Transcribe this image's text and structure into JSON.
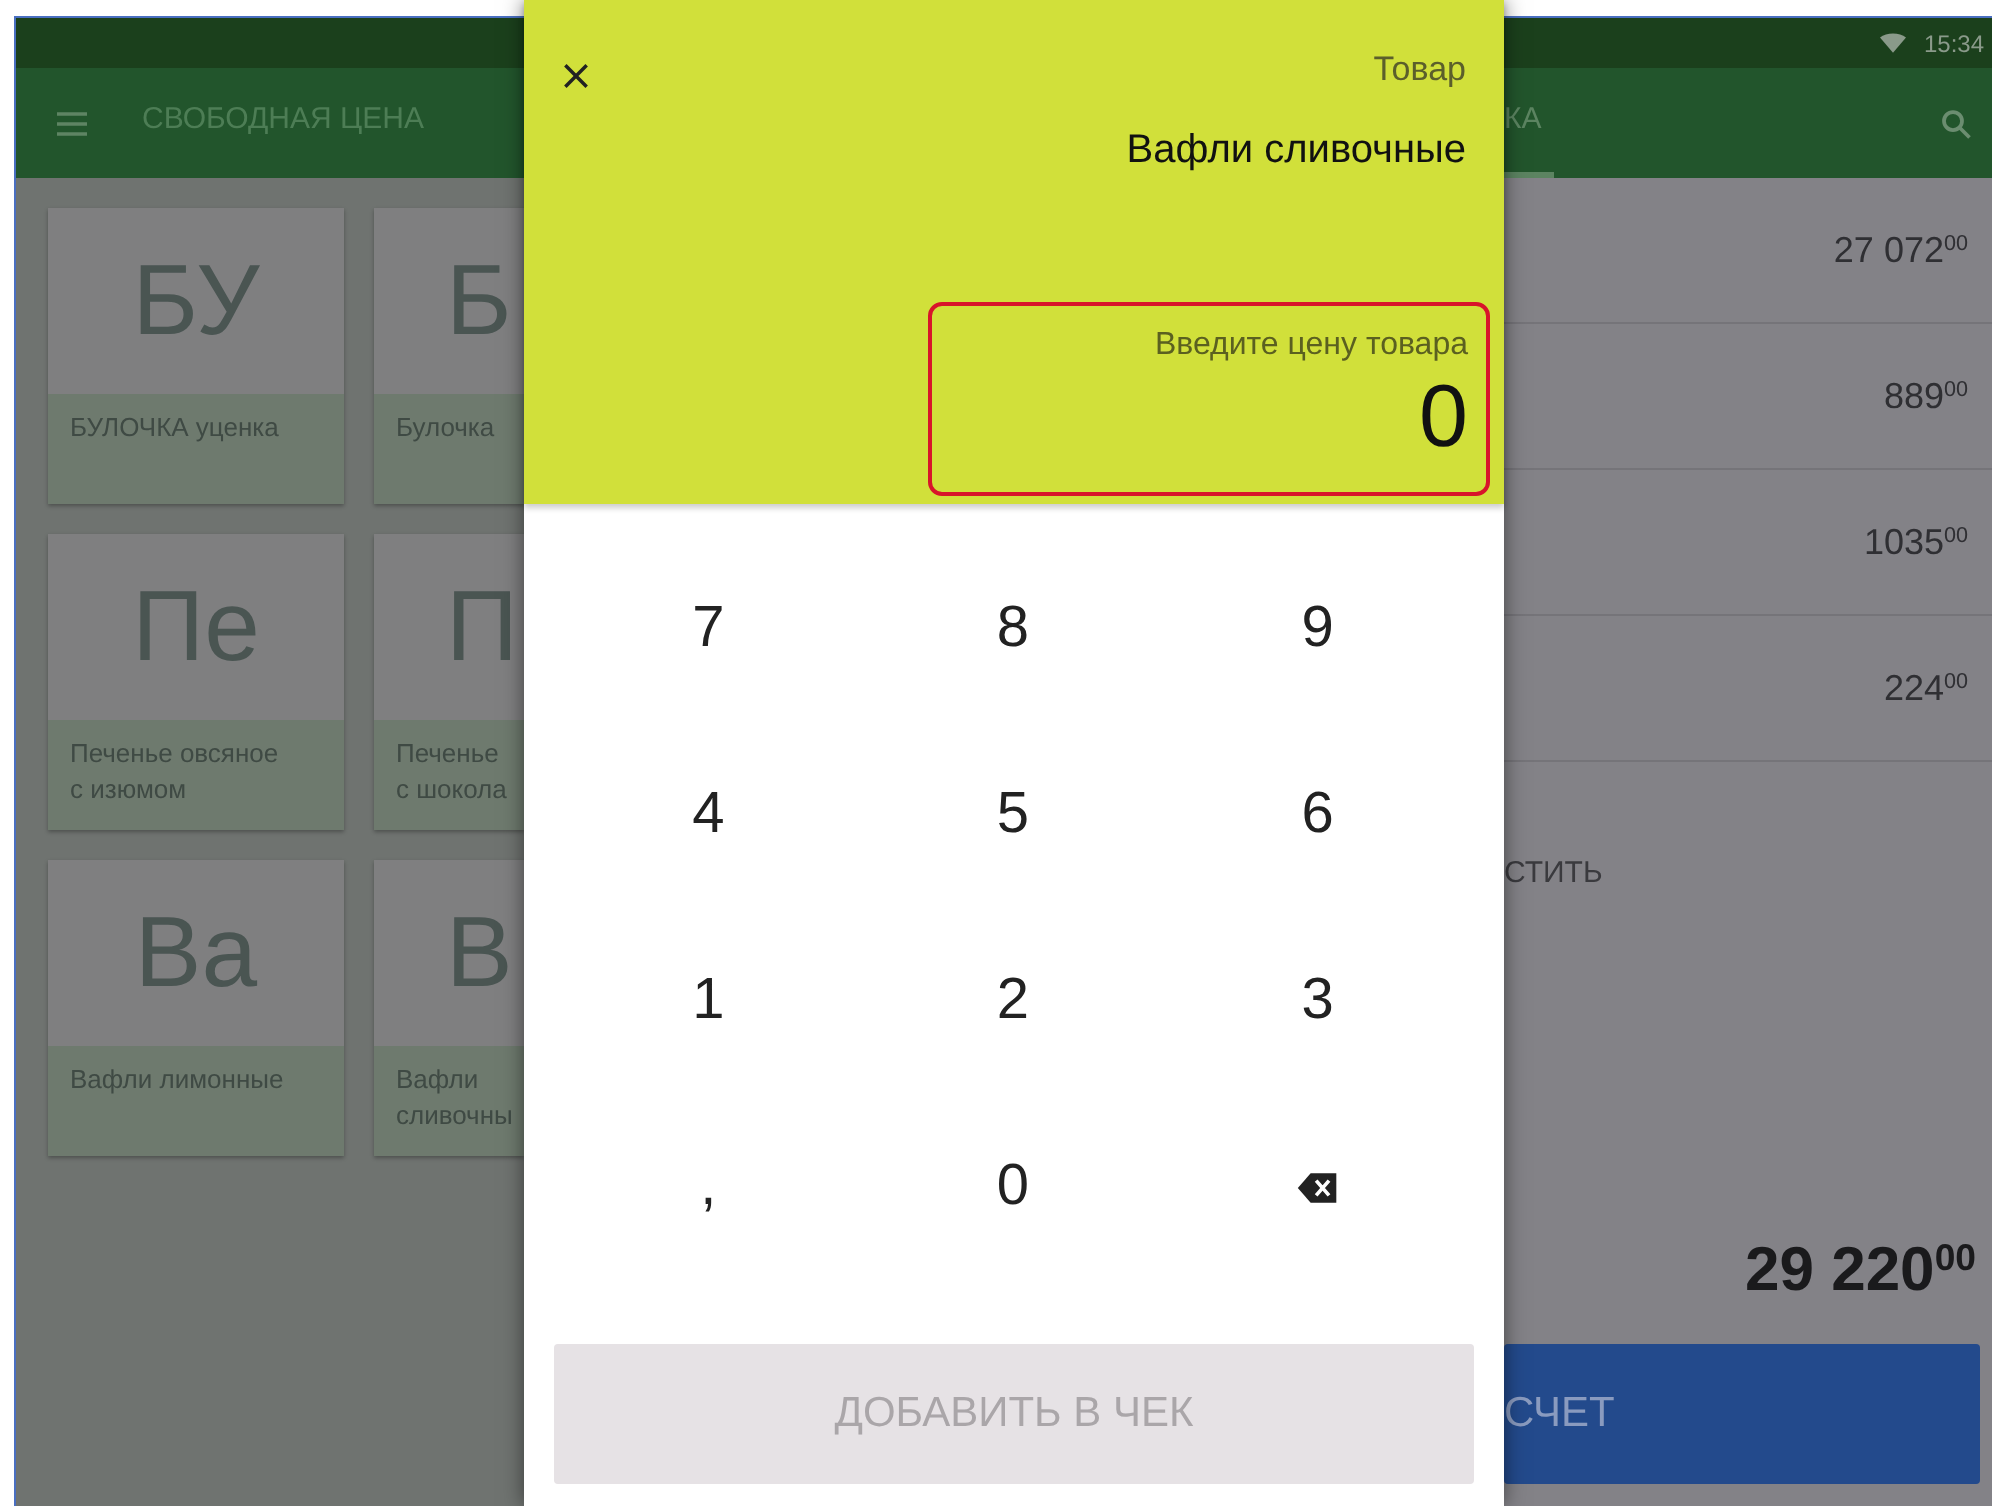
{
  "status_bar": {
    "time": "15:34"
  },
  "toolbar": {
    "tabs": [
      {
        "label": "СВОБОДНАЯ ЦЕНА",
        "selected": false
      },
      {
        "label": "КА",
        "selected": true
      }
    ]
  },
  "products": [
    {
      "initials": "БУ",
      "name": "БУЛОЧКА уценка"
    },
    {
      "initials": "Б",
      "name": "Булочка"
    },
    {
      "initials": "Пе",
      "name": "Печенье овсяное\nс изюмом"
    },
    {
      "initials": "П",
      "name": "Печенье\nс шокола"
    },
    {
      "initials": "Ва",
      "name": "Вафли лимонные"
    },
    {
      "initials": "В",
      "name": "Вафли\nсливочны"
    }
  ],
  "receipt": {
    "rows": [
      {
        "amount": "27 072$^{00}$"
      },
      {
        "amount": "889$^{00}$"
      },
      {
        "amount": "1035$^{00}$"
      },
      {
        "amount": "224$^{00}$"
      }
    ],
    "clear_button": "СТИТЬ",
    "total": "29 220$^{00}$",
    "pay_button": "СЧЕТ"
  },
  "dialog": {
    "subtitle": "Товар",
    "title": "Вафли сливочные",
    "price_field": {
      "label": "Введите цену товара",
      "value": "0"
    },
    "keys": [
      {
        "kind": "digit",
        "label": "7"
      },
      {
        "kind": "digit",
        "label": "8"
      },
      {
        "kind": "digit",
        "label": "9"
      },
      {
        "kind": "digit",
        "label": "4"
      },
      {
        "kind": "digit",
        "label": "5"
      },
      {
        "kind": "digit",
        "label": "6"
      },
      {
        "kind": "digit",
        "label": "1"
      },
      {
        "kind": "digit",
        "label": "2"
      },
      {
        "kind": "digit",
        "label": "3"
      },
      {
        "kind": "digit",
        "label": ","
      },
      {
        "kind": "digit",
        "label": "0"
      },
      {
        "kind": "backspace"
      }
    ],
    "add_button": {
      "label": "ДОБАВИТЬ В ЧЕК",
      "disabled": true
    }
  }
}
